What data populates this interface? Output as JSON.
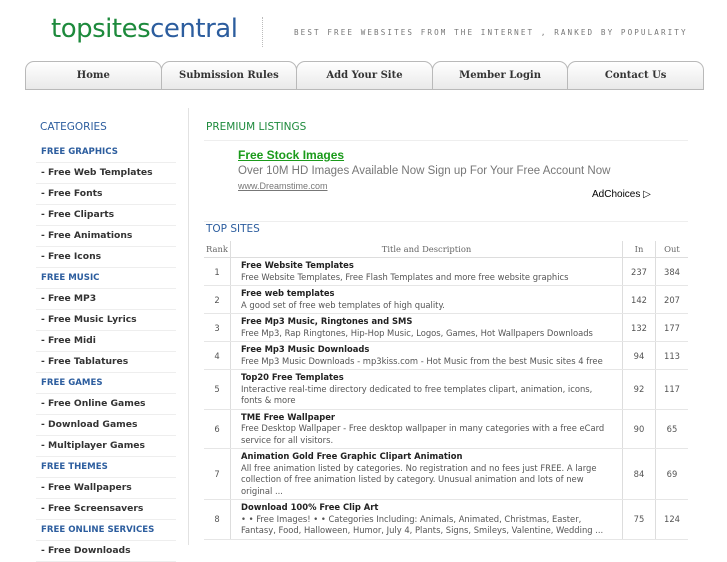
{
  "header": {
    "logo_part1": "topsites",
    "logo_part2": "central",
    "tagline": "BEST FREE WEBSITES FROM THE INTERNET , RANKED BY POPULARITY"
  },
  "nav": [
    {
      "label": "Home"
    },
    {
      "label": "Submission Rules"
    },
    {
      "label": "Add Your Site"
    },
    {
      "label": "Member Login"
    },
    {
      "label": "Contact Us"
    }
  ],
  "sidebar": {
    "title": "CATEGORIES",
    "items": [
      {
        "label": "FREE GRAPHICS",
        "type": "cat"
      },
      {
        "label": "- Free Web Templates",
        "type": "sub"
      },
      {
        "label": "- Free Fonts",
        "type": "sub"
      },
      {
        "label": "- Free Cliparts",
        "type": "sub"
      },
      {
        "label": "- Free Animations",
        "type": "sub"
      },
      {
        "label": "- Free Icons",
        "type": "sub"
      },
      {
        "label": "FREE MUSIC",
        "type": "cat"
      },
      {
        "label": "- Free MP3",
        "type": "sub"
      },
      {
        "label": "- Free Music Lyrics",
        "type": "sub"
      },
      {
        "label": "- Free Midi",
        "type": "sub"
      },
      {
        "label": "- Free Tablatures",
        "type": "sub"
      },
      {
        "label": "FREE GAMES",
        "type": "cat"
      },
      {
        "label": "- Free Online Games",
        "type": "sub"
      },
      {
        "label": "- Download Games",
        "type": "sub"
      },
      {
        "label": "- Multiplayer Games",
        "type": "sub"
      },
      {
        "label": "FREE THEMES",
        "type": "cat"
      },
      {
        "label": "- Free Wallpapers",
        "type": "sub"
      },
      {
        "label": "- Free Screensavers",
        "type": "sub"
      },
      {
        "label": "FREE ONLINE SERVICES",
        "type": "cat"
      },
      {
        "label": "- Free Downloads",
        "type": "sub"
      }
    ]
  },
  "premium": {
    "title": "PREMIUM LISTINGS",
    "ad_title": "Free Stock Images",
    "ad_text": "Over 10M HD Images Available Now Sign up For Your Free Account Now",
    "ad_url": "www.Dreamstime.com",
    "adchoices": "AdChoices"
  },
  "top": {
    "title": "TOP SITES",
    "columns": {
      "rank": "Rank",
      "title": "Title and Description",
      "in": "In",
      "out": "Out"
    },
    "rows": [
      {
        "rank": "1",
        "title": "Free Website Templates",
        "desc": "Free Website Templates, Free Flash Templates and more free website graphics",
        "in": "237",
        "out": "384"
      },
      {
        "rank": "2",
        "title": "Free web templates",
        "desc": "A good set of free web templates of high quality.",
        "in": "142",
        "out": "207"
      },
      {
        "rank": "3",
        "title": "Free Mp3 Music, Ringtones and SMS",
        "desc": "Free Mp3, Rap Ringtones, Hip-Hop Music, Logos, Games, Hot Wallpapers Downloads",
        "in": "132",
        "out": "177"
      },
      {
        "rank": "4",
        "title": "Free Mp3 Music Downloads",
        "desc": "Free Mp3 Music Downloads - mp3kiss.com - Hot Music from the best Music sites 4 free",
        "in": "94",
        "out": "113"
      },
      {
        "rank": "5",
        "title": "Top20 Free Templates",
        "desc": "Interactive real-time directory dedicated to free templates clipart, animation, icons, fonts & more",
        "in": "92",
        "out": "117"
      },
      {
        "rank": "6",
        "title": "TME Free Wallpaper",
        "desc": "Free Desktop Wallpaper - Free desktop wallpaper in many categories with a free eCard service for all visitors.",
        "in": "90",
        "out": "65"
      },
      {
        "rank": "7",
        "title": "Animation Gold Free Graphic Clipart Animation",
        "desc": "All free animation listed by categories. No registration and no fees just FREE. A large collection of free animation listed by category. Unusual animation and lots of new original ...",
        "in": "84",
        "out": "69"
      },
      {
        "rank": "8",
        "title": "Download 100% Free Clip Art",
        "desc": "• • Free Images! • • Categories Including: Animals, Animated, Christmas, Easter, Fantasy, Food, Halloween, Humor, July 4, Plants, Signs, Smileys, Valentine, Wedding ...",
        "in": "75",
        "out": "124"
      }
    ]
  }
}
